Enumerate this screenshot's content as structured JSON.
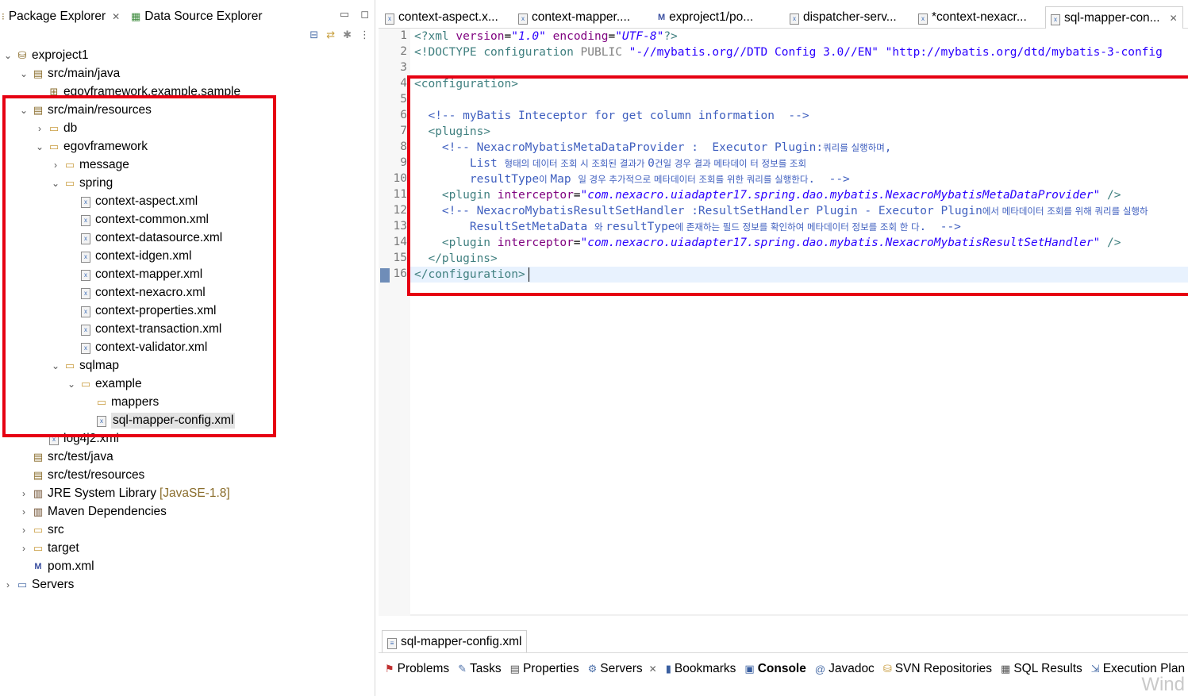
{
  "left": {
    "tabs": [
      {
        "label": "Package Explorer",
        "icon": "package-explorer-icon",
        "closable": true
      },
      {
        "label": "Data Source Explorer",
        "icon": "data-source-icon",
        "closable": false
      }
    ],
    "window_controls": [
      "minimize",
      "maximize"
    ],
    "toolbar_icons": [
      "collapse-all-icon",
      "link-with-editor-icon",
      "filter-icon",
      "view-menu-icon"
    ],
    "tree": [
      {
        "label": "exproject1",
        "expanded": true,
        "icon": "project-icon"
      },
      {
        "label": "src/main/java",
        "expanded": true,
        "icon": "source-folder-icon"
      },
      {
        "label": "egovframework.example.sample",
        "icon": "package-icon"
      },
      {
        "label": "src/main/resources",
        "expanded": true,
        "icon": "source-folder-icon"
      },
      {
        "label": "db",
        "expanded": false,
        "icon": "folder-icon"
      },
      {
        "label": "egovframework",
        "expanded": true,
        "icon": "folder-icon"
      },
      {
        "label": "message",
        "expanded": false,
        "icon": "folder-icon"
      },
      {
        "label": "spring",
        "expanded": true,
        "icon": "folder-icon"
      },
      {
        "label": "context-aspect.xml",
        "icon": "xml-file-icon"
      },
      {
        "label": "context-common.xml",
        "icon": "xml-file-icon"
      },
      {
        "label": "context-datasource.xml",
        "icon": "xml-file-icon"
      },
      {
        "label": "context-idgen.xml",
        "icon": "xml-file-icon"
      },
      {
        "label": "context-mapper.xml",
        "icon": "xml-file-icon"
      },
      {
        "label": "context-nexacro.xml",
        "icon": "xml-file-icon"
      },
      {
        "label": "context-properties.xml",
        "icon": "xml-file-icon"
      },
      {
        "label": "context-transaction.xml",
        "icon": "xml-file-icon"
      },
      {
        "label": "context-validator.xml",
        "icon": "xml-file-icon"
      },
      {
        "label": "sqlmap",
        "expanded": true,
        "icon": "folder-icon"
      },
      {
        "label": "example",
        "expanded": true,
        "icon": "folder-icon"
      },
      {
        "label": "mappers",
        "icon": "folder-icon"
      },
      {
        "label": "sql-mapper-config.xml",
        "icon": "xml-file-icon",
        "selected": true
      },
      {
        "label": "log4j2.xml",
        "icon": "xml-file-icon"
      },
      {
        "label": "src/test/java",
        "icon": "source-folder-icon"
      },
      {
        "label": "src/test/resources",
        "icon": "source-folder-icon"
      },
      {
        "label": "JRE System Library",
        "sub": "[JavaSE-1.8]",
        "expanded": false,
        "icon": "library-icon"
      },
      {
        "label": "Maven Dependencies",
        "expanded": false,
        "icon": "library-icon"
      },
      {
        "label": "src",
        "expanded": false,
        "icon": "folder-icon"
      },
      {
        "label": "target",
        "expanded": false,
        "icon": "folder-icon"
      },
      {
        "label": "pom.xml",
        "icon": "maven-file-icon"
      },
      {
        "label": "Servers",
        "expanded": false,
        "icon": "folder-icon"
      }
    ]
  },
  "editor": {
    "tabs": [
      {
        "label": "context-aspect.x...",
        "icon": "xml-file-icon"
      },
      {
        "label": "context-mapper....",
        "icon": "xml-file-icon"
      },
      {
        "label": "exproject1/po...",
        "icon": "maven-file-icon"
      },
      {
        "label": "dispatcher-serv...",
        "icon": "xml-file-icon"
      },
      {
        "label": "*context-nexacr...",
        "icon": "xml-file-icon"
      },
      {
        "label": "sql-mapper-con...",
        "icon": "xml-file-icon",
        "active": true
      }
    ],
    "line_numbers": [
      "1",
      "2",
      "3",
      "4",
      "5",
      "6",
      "7",
      "8",
      "9",
      "10",
      "11",
      "12",
      "13",
      "14",
      "15",
      "16"
    ],
    "code": {
      "l1_a": "<?xml ",
      "l1_b": "version",
      "l1_c": "=",
      "l1_d": "\"1.0\"",
      "l1_e": " ",
      "l1_f": "encoding",
      "l1_g": "=",
      "l1_h": "\"UTF-8\"",
      "l1_i": "?>",
      "l2_a": "<!DOCTYPE ",
      "l2_b": "configuration",
      "l2_c": " PUBLIC ",
      "l2_d": "\"-//mybatis.org//DTD Config 3.0//EN\"",
      "l2_e": " ",
      "l2_f": "\"http://mybatis.org/dtd/mybatis-3-config",
      "l4": "<configuration>",
      "l6": "  <!-- myBatis Inteceptor for get column information  -->",
      "l7": "  <plugins>",
      "l8_a": "    <!-- NexacroMybatisMetaDataProvider :  Executor Plugin:",
      "l8_b": "쿼리를 실행하며",
      "l8_c": ",",
      "l9_a": "        List ",
      "l9_b": "형태의 데이터 조회 시 조회된 결과가 ",
      "l9_c": "0",
      "l9_d": "건일 경우 결과 메타데이 터 정보를 조회",
      "l10_a": "        resultType",
      "l10_b": "이 ",
      "l10_c": "Map ",
      "l10_d": "일 경우 추가적으로 메타데이터 조회를 위한 쿼리를 실행한다",
      "l10_e": ".  -->",
      "l11_a": "    <plugin ",
      "l11_b": "interceptor",
      "l11_c": "=",
      "l11_d": "\"com.nexacro.uiadapter17.spring.dao.mybatis.NexacroMybatisMetaDataProvider\"",
      "l11_e": " />",
      "l12_a": "    <!-- NexacroMybatisResultSetHandler :ResultSetHandler Plugin - Executor Plugin",
      "l12_b": "에서 메타데이터 조회를 위해 쿼리를 실행하",
      "l13_a": "        ResultSetMetaData ",
      "l13_b": "와 ",
      "l13_c": "resultType",
      "l13_d": "에 존재하는 필드 정보를 확인하여 메타데이터 정보를 조회 한 다",
      "l13_e": ".  -->",
      "l14_a": "    <plugin ",
      "l14_b": "interceptor",
      "l14_c": "=",
      "l14_d": "\"com.nexacro.uiadapter17.spring.dao.mybatis.NexacroMybatisResultSetHandler\"",
      "l14_e": " />",
      "l15": "  </plugins>",
      "l16": "</configuration>"
    },
    "bottom_tab": "sql-mapper-config.xml"
  },
  "views": {
    "tabs": [
      {
        "label": "Problems",
        "icon": "problems-icon"
      },
      {
        "label": "Tasks",
        "icon": "tasks-icon"
      },
      {
        "label": "Properties",
        "icon": "properties-icon"
      },
      {
        "label": "Servers",
        "icon": "servers-icon",
        "closable": true
      },
      {
        "label": "Bookmarks",
        "icon": "bookmarks-icon"
      },
      {
        "label": "Console",
        "icon": "console-icon",
        "active": true
      },
      {
        "label": "Javadoc",
        "icon": "javadoc-icon"
      },
      {
        "label": "SVN Repositories",
        "icon": "svn-icon"
      },
      {
        "label": "SQL Results",
        "icon": "sql-results-icon"
      },
      {
        "label": "Execution Plan",
        "icon": "execution-plan-icon"
      }
    ],
    "watermark": "Wind"
  },
  "colors": {
    "highlight_box": "#e60012",
    "xml_tag": "#3f7f7f",
    "xml_attr": "#7f007f",
    "xml_string": "#2a00ff",
    "xml_comment": "#3f5fbf"
  }
}
